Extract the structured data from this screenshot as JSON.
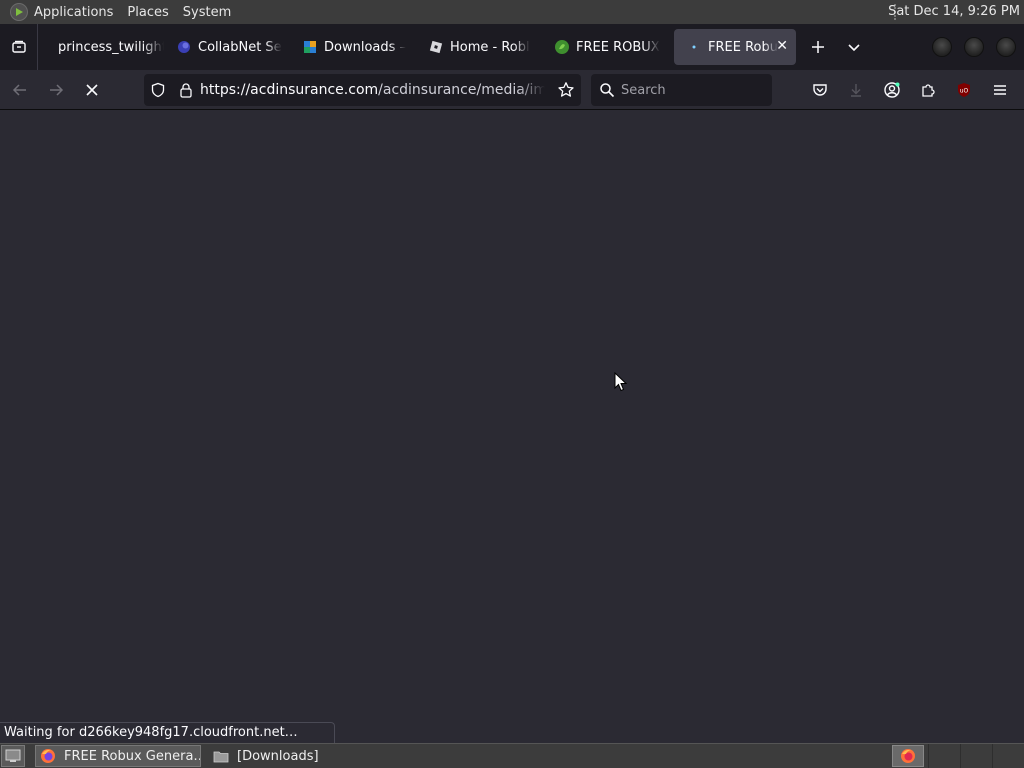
{
  "panel": {
    "menus": [
      "Applications",
      "Places",
      "System"
    ],
    "clock": "Sat Dec 14,  9:26 PM"
  },
  "tabs": [
    {
      "title": "princess_twilight",
      "favicon": "blank-icon"
    },
    {
      "title": "CollabNet Se",
      "favicon": "collabnet-icon"
    },
    {
      "title": "Downloads –",
      "favicon": "downloads-icon"
    },
    {
      "title": "Home - Robl",
      "favicon": "roblox-icon"
    },
    {
      "title": "FREE ROBUX",
      "favicon": "green-leaf-icon"
    },
    {
      "title": "FREE Robu",
      "favicon": "loading-dot-icon",
      "active": true
    }
  ],
  "navbar": {
    "url_host": "https://acdinsurance.com",
    "url_path": "/acdinsurance/media/images/",
    "search_placeholder": "Search"
  },
  "status": {
    "text": "Waiting for d266key948fg17.cloudfront.net…"
  },
  "taskbar": {
    "items": [
      {
        "label": "FREE Robux Genera…",
        "icon": "firefox-icon",
        "active": true
      },
      {
        "label": "[Downloads]",
        "icon": "folder-icon",
        "active": false
      }
    ]
  },
  "colors": {
    "content_bg": "#2b2a33",
    "toolbar_bg": "#2b2a33",
    "tabstrip_bg": "#1c1b22",
    "active_tab_bg": "#42414d",
    "panel_bg": "#3c3c3c"
  }
}
